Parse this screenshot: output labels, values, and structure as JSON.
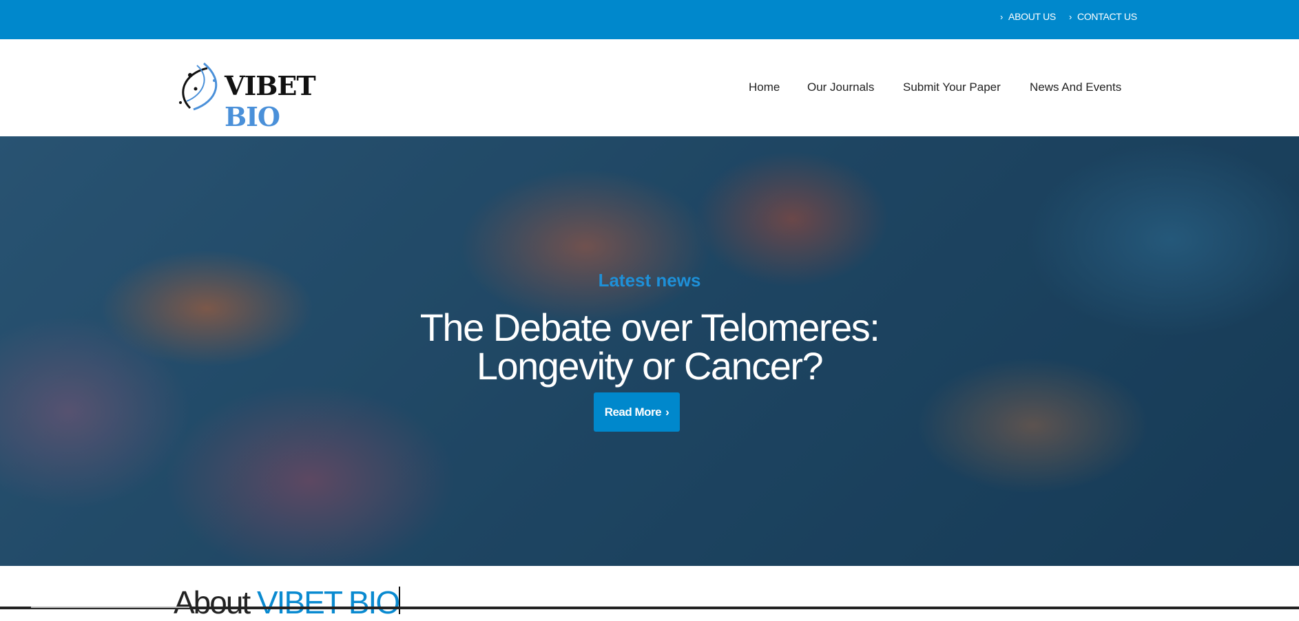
{
  "topbar": {
    "links": [
      {
        "label": "ABOUT US",
        "icon": "chevron-right-icon"
      },
      {
        "label": "CONTACT US",
        "icon": "chevron-right-icon"
      }
    ]
  },
  "header": {
    "logo": {
      "word1": "VIBET",
      "word2": "BIO"
    },
    "nav": [
      "Home",
      "Our Journals",
      "Submit Your Paper",
      "News And Events"
    ]
  },
  "hero": {
    "kicker": "Latest news",
    "title_line1": "The Debate over Telomeres:",
    "title_line2": "Longevity or Cancer?",
    "button_label": "Read More",
    "colors": {
      "accent": "#0088cc"
    }
  },
  "about": {
    "prefix": "About",
    "highlight": "VIBET BIO"
  }
}
